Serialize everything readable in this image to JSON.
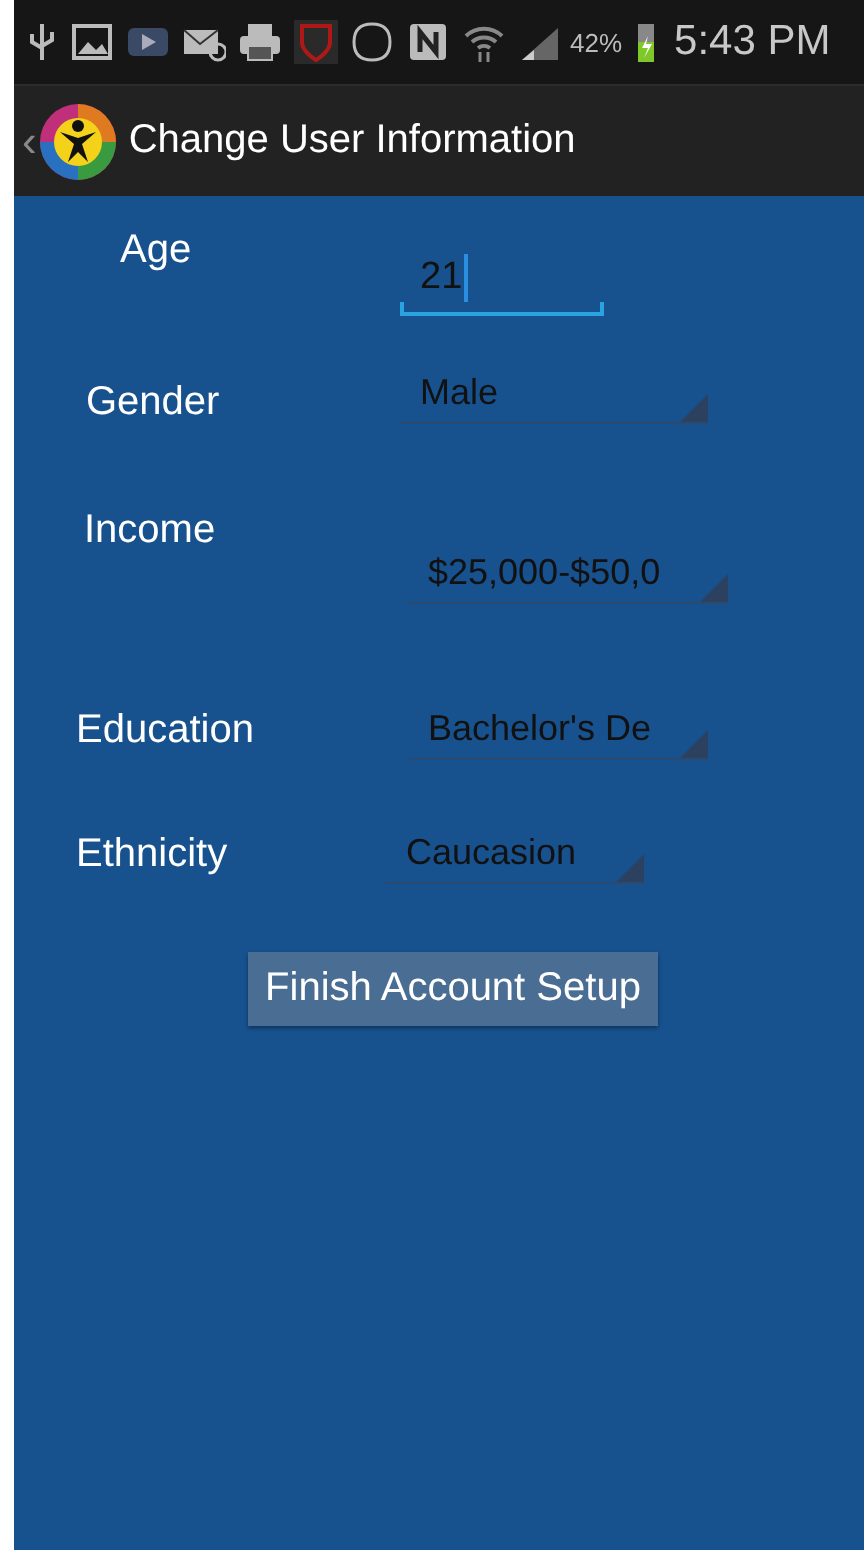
{
  "status_bar": {
    "battery": "42%",
    "time": "5:43 PM"
  },
  "action_bar": {
    "back": "‹",
    "title": "Change User Information"
  },
  "fields": [
    {
      "kind": "text",
      "label": "Age",
      "value": "21",
      "focused": true
    },
    {
      "kind": "spinner",
      "label": "Gender",
      "value": "Male"
    },
    {
      "kind": "spinner",
      "label": "Income",
      "value": "$25,000-$50,0"
    },
    {
      "kind": "spinner",
      "label": "Education",
      "value": "Bachelor's De"
    },
    {
      "kind": "spinner",
      "label": "Ethnicity",
      "value": "Caucasion"
    }
  ],
  "button": {
    "label": "Finish Account Setup"
  }
}
